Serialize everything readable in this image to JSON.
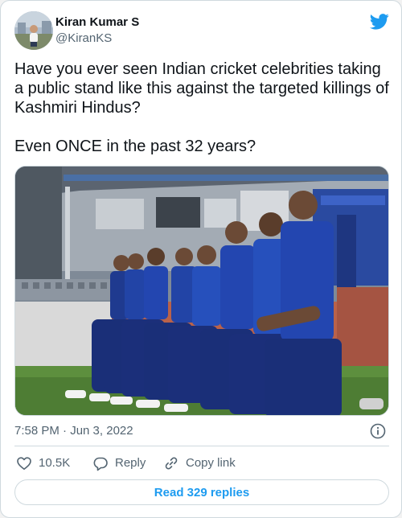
{
  "author": {
    "display_name": "Kiran Kumar S",
    "handle": "@KiranKS",
    "avatar_icon": "profile-photo"
  },
  "brand": {
    "icon": "twitter-bird-icon",
    "color": "#1d9bf0"
  },
  "tweet": {
    "text": "Have you ever seen Indian cricket celebrities taking a public stand like this against the targeted killings of Kashmiri Hindus?\n\nEven ONCE in the past 32 years?",
    "media_description_icon": "photo"
  },
  "meta": {
    "timestamp": "7:58 PM · Jun 3, 2022",
    "info_icon": "info-icon"
  },
  "actions": {
    "like_count": "10.5K",
    "reply_label": "Reply",
    "copy_label": "Copy link"
  },
  "footer": {
    "read_replies_label": "Read 329 replies"
  },
  "colors": {
    "text_primary": "#0f1419",
    "text_secondary": "#536471",
    "accent": "#1d9bf0",
    "border": "#cfd9de",
    "jersey_blue": "#1f3a8f"
  }
}
